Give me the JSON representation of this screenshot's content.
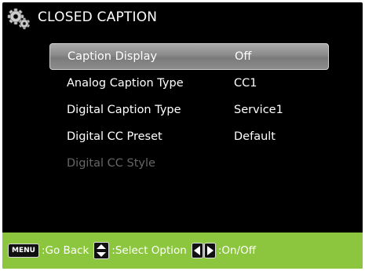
{
  "header": {
    "title": "CLOSED CAPTION",
    "icon": "gears-icon"
  },
  "menu": {
    "items": [
      {
        "label": "Caption Display",
        "value": "Off",
        "selected": true,
        "enabled": true
      },
      {
        "label": "Analog Caption Type",
        "value": "CC1",
        "selected": false,
        "enabled": true
      },
      {
        "label": "Digital Caption Type",
        "value": "Service1",
        "selected": false,
        "enabled": true
      },
      {
        "label": "Digital CC Preset",
        "value": "Default",
        "selected": false,
        "enabled": true
      },
      {
        "label": "Digital CC Style",
        "value": "",
        "selected": false,
        "enabled": false
      }
    ]
  },
  "footer": {
    "menu_key": "MENU",
    "go_back": ":Go Back",
    "select_option": ":Select Option",
    "on_off": ":On/Off",
    "color": "#8cc63e"
  }
}
